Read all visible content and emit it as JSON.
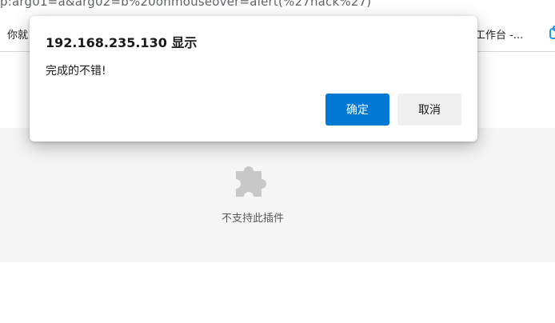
{
  "browser": {
    "address_partial": "p:arg01=a&arg02=b%20onmouseover=alert(%27hack%27)",
    "bookmarks": {
      "left_label": "你就",
      "right_label": "工作台 -..."
    }
  },
  "content": {
    "plugin_message": "不支持此插件",
    "plugin_icon": "puzzle-piece-icon"
  },
  "dialog": {
    "title": "192.168.235.130 显示",
    "message": "完成的不错!",
    "ok_label": "确定",
    "cancel_label": "取消"
  },
  "colors": {
    "primary_button": "#0078d4",
    "secondary_button": "#efefef",
    "plugin_background": "#f5f5f5",
    "puzzle_icon": "#c8c8c8"
  }
}
